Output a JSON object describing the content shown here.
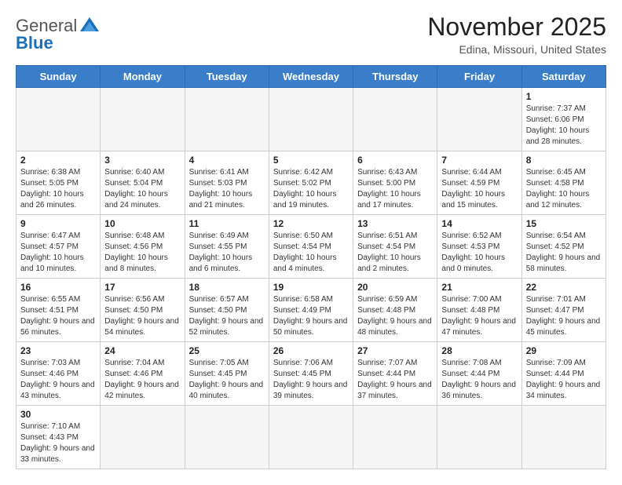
{
  "logo": {
    "text_general": "General",
    "text_blue": "Blue"
  },
  "header": {
    "month_year": "November 2025",
    "location": "Edina, Missouri, United States"
  },
  "days_of_week": [
    "Sunday",
    "Monday",
    "Tuesday",
    "Wednesday",
    "Thursday",
    "Friday",
    "Saturday"
  ],
  "weeks": [
    [
      {
        "day": "",
        "info": ""
      },
      {
        "day": "",
        "info": ""
      },
      {
        "day": "",
        "info": ""
      },
      {
        "day": "",
        "info": ""
      },
      {
        "day": "",
        "info": ""
      },
      {
        "day": "",
        "info": ""
      },
      {
        "day": "1",
        "info": "Sunrise: 7:37 AM\nSunset: 6:06 PM\nDaylight: 10 hours and 28 minutes."
      }
    ],
    [
      {
        "day": "2",
        "info": "Sunrise: 6:38 AM\nSunset: 5:05 PM\nDaylight: 10 hours and 26 minutes."
      },
      {
        "day": "3",
        "info": "Sunrise: 6:40 AM\nSunset: 5:04 PM\nDaylight: 10 hours and 24 minutes."
      },
      {
        "day": "4",
        "info": "Sunrise: 6:41 AM\nSunset: 5:03 PM\nDaylight: 10 hours and 21 minutes."
      },
      {
        "day": "5",
        "info": "Sunrise: 6:42 AM\nSunset: 5:02 PM\nDaylight: 10 hours and 19 minutes."
      },
      {
        "day": "6",
        "info": "Sunrise: 6:43 AM\nSunset: 5:00 PM\nDaylight: 10 hours and 17 minutes."
      },
      {
        "day": "7",
        "info": "Sunrise: 6:44 AM\nSunset: 4:59 PM\nDaylight: 10 hours and 15 minutes."
      },
      {
        "day": "8",
        "info": "Sunrise: 6:45 AM\nSunset: 4:58 PM\nDaylight: 10 hours and 12 minutes."
      }
    ],
    [
      {
        "day": "9",
        "info": "Sunrise: 6:47 AM\nSunset: 4:57 PM\nDaylight: 10 hours and 10 minutes."
      },
      {
        "day": "10",
        "info": "Sunrise: 6:48 AM\nSunset: 4:56 PM\nDaylight: 10 hours and 8 minutes."
      },
      {
        "day": "11",
        "info": "Sunrise: 6:49 AM\nSunset: 4:55 PM\nDaylight: 10 hours and 6 minutes."
      },
      {
        "day": "12",
        "info": "Sunrise: 6:50 AM\nSunset: 4:54 PM\nDaylight: 10 hours and 4 minutes."
      },
      {
        "day": "13",
        "info": "Sunrise: 6:51 AM\nSunset: 4:54 PM\nDaylight: 10 hours and 2 minutes."
      },
      {
        "day": "14",
        "info": "Sunrise: 6:52 AM\nSunset: 4:53 PM\nDaylight: 10 hours and 0 minutes."
      },
      {
        "day": "15",
        "info": "Sunrise: 6:54 AM\nSunset: 4:52 PM\nDaylight: 9 hours and 58 minutes."
      }
    ],
    [
      {
        "day": "16",
        "info": "Sunrise: 6:55 AM\nSunset: 4:51 PM\nDaylight: 9 hours and 56 minutes."
      },
      {
        "day": "17",
        "info": "Sunrise: 6:56 AM\nSunset: 4:50 PM\nDaylight: 9 hours and 54 minutes."
      },
      {
        "day": "18",
        "info": "Sunrise: 6:57 AM\nSunset: 4:50 PM\nDaylight: 9 hours and 52 minutes."
      },
      {
        "day": "19",
        "info": "Sunrise: 6:58 AM\nSunset: 4:49 PM\nDaylight: 9 hours and 50 minutes."
      },
      {
        "day": "20",
        "info": "Sunrise: 6:59 AM\nSunset: 4:48 PM\nDaylight: 9 hours and 48 minutes."
      },
      {
        "day": "21",
        "info": "Sunrise: 7:00 AM\nSunset: 4:48 PM\nDaylight: 9 hours and 47 minutes."
      },
      {
        "day": "22",
        "info": "Sunrise: 7:01 AM\nSunset: 4:47 PM\nDaylight: 9 hours and 45 minutes."
      }
    ],
    [
      {
        "day": "23",
        "info": "Sunrise: 7:03 AM\nSunset: 4:46 PM\nDaylight: 9 hours and 43 minutes."
      },
      {
        "day": "24",
        "info": "Sunrise: 7:04 AM\nSunset: 4:46 PM\nDaylight: 9 hours and 42 minutes."
      },
      {
        "day": "25",
        "info": "Sunrise: 7:05 AM\nSunset: 4:45 PM\nDaylight: 9 hours and 40 minutes."
      },
      {
        "day": "26",
        "info": "Sunrise: 7:06 AM\nSunset: 4:45 PM\nDaylight: 9 hours and 39 minutes."
      },
      {
        "day": "27",
        "info": "Sunrise: 7:07 AM\nSunset: 4:44 PM\nDaylight: 9 hours and 37 minutes."
      },
      {
        "day": "28",
        "info": "Sunrise: 7:08 AM\nSunset: 4:44 PM\nDaylight: 9 hours and 36 minutes."
      },
      {
        "day": "29",
        "info": "Sunrise: 7:09 AM\nSunset: 4:44 PM\nDaylight: 9 hours and 34 minutes."
      }
    ],
    [
      {
        "day": "30",
        "info": "Sunrise: 7:10 AM\nSunset: 4:43 PM\nDaylight: 9 hours and 33 minutes."
      },
      {
        "day": "",
        "info": ""
      },
      {
        "day": "",
        "info": ""
      },
      {
        "day": "",
        "info": ""
      },
      {
        "day": "",
        "info": ""
      },
      {
        "day": "",
        "info": ""
      },
      {
        "day": "",
        "info": ""
      }
    ]
  ]
}
